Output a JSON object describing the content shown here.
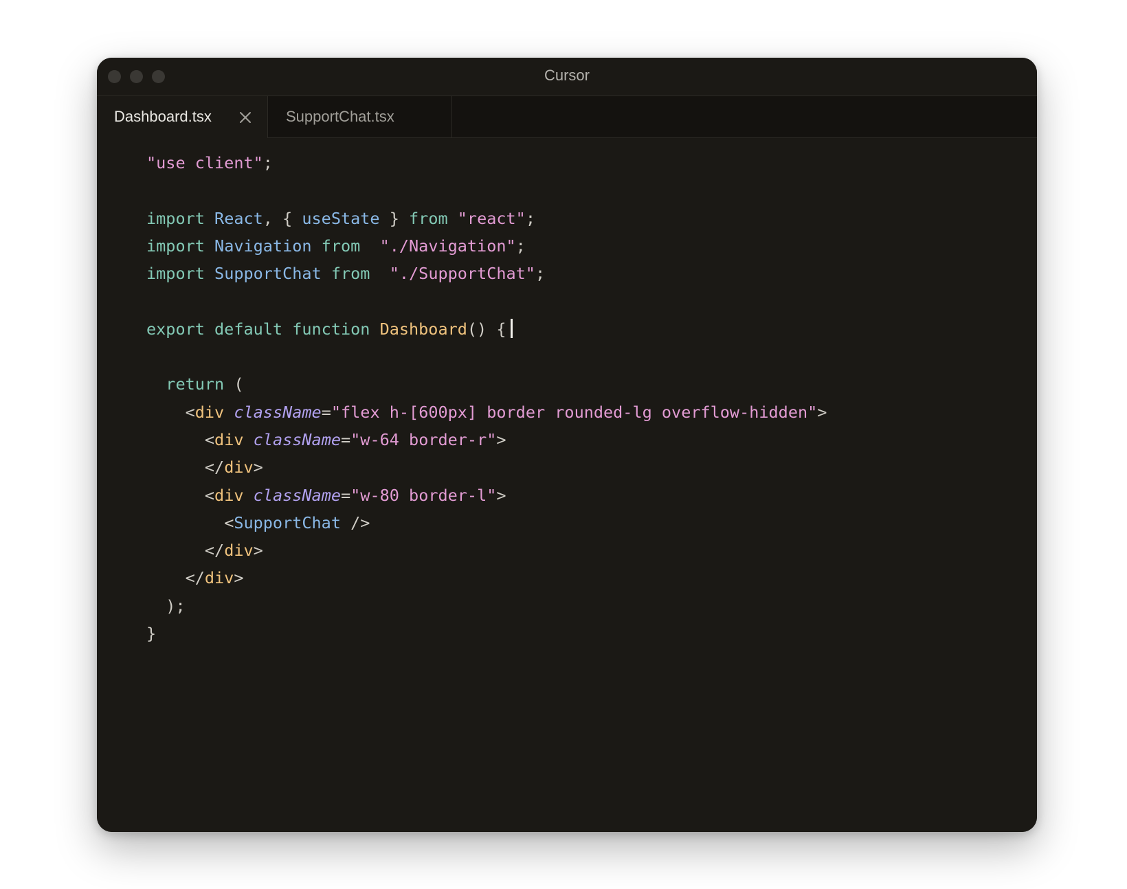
{
  "window": {
    "title": "Cursor"
  },
  "tabs": [
    {
      "label": "Dashboard.tsx",
      "active": true,
      "close_icon": "close-icon"
    },
    {
      "label": "SupportChat.tsx",
      "active": false
    }
  ],
  "colors": {
    "keyword": "#83c9b5",
    "identifier": "#8ab8e6",
    "string": "#e29bd3",
    "function": "#efc27d",
    "attribute": "#b1a1ef",
    "background": "#1b1915"
  },
  "code": {
    "l1": {
      "str": "\"use client\"",
      "p": ";"
    },
    "l3": {
      "k1": "import ",
      "i1": "React",
      "p1": ", { ",
      "i2": "useState",
      "p2": " } ",
      "k2": "from ",
      "s": "\"react\"",
      "p3": ";"
    },
    "l4": {
      "k1": "import ",
      "i1": "Navigation",
      "k2": " from ",
      "s": "\"./Navigation\"",
      "p": ";"
    },
    "l5": {
      "k1": "import ",
      "i1": "SupportChat",
      "k2": " from ",
      "s": "\"./SupportChat\"",
      "p": ";"
    },
    "l7": {
      "k": "export default function ",
      "f": "Dashboard",
      "p": "() {"
    },
    "l9": {
      "k": "return",
      "p": " ("
    },
    "l10": {
      "p1": "<",
      "t": "div",
      "a": "className",
      "eq": "=",
      "s": "\"flex h-[600px] border rounded-lg overflow-hidden\"",
      "p2": ">"
    },
    "l11": {
      "p1": "<",
      "t": "div",
      "a": "className",
      "eq": "=",
      "s": "\"w-64 border-r\"",
      "p2": ">"
    },
    "l12": {
      "p1": "</",
      "t": "div",
      "p2": ">"
    },
    "l13": {
      "p1": "<",
      "t": "div",
      "a": "className",
      "eq": "=",
      "s": "\"w-80 border-l\"",
      "p2": ">"
    },
    "l14": {
      "p1": "<",
      "c": "SupportChat",
      "p2": " />"
    },
    "l15": {
      "p1": "</",
      "t": "div",
      "p2": ">"
    },
    "l16": {
      "p1": "</",
      "t": "div",
      "p2": ">"
    },
    "l17": {
      "p": ");"
    },
    "l18": {
      "p": "}"
    }
  }
}
